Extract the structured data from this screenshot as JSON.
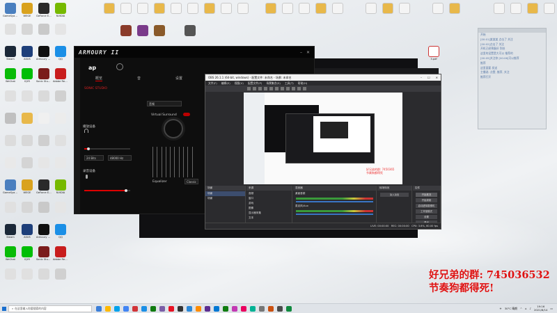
{
  "desktop": {
    "icons": [
      {
        "label": "GameSyaplay",
        "color": "#4a7fbf"
      },
      {
        "label": "WEGE",
        "color": "#d9a21e"
      },
      {
        "label": "GeForce Experience",
        "color": "#2a2a2a"
      },
      {
        "label": "NVIDIA",
        "color": "#76b900"
      },
      {
        "label": "",
        "color": "#e0e0e0"
      },
      {
        "label": "",
        "color": "#d6d6d6"
      },
      {
        "label": "",
        "color": "#c9c9c9"
      },
      {
        "label": "",
        "color": "#e5e5e5"
      },
      {
        "label": "Steam",
        "color": "#1b2838"
      },
      {
        "label": "ASUS",
        "color": "#1e3f7a"
      },
      {
        "label": "Armoury Crate",
        "color": "#101010"
      },
      {
        "label": "QQ",
        "color": "#1b8fe6"
      },
      {
        "label": "WeChat",
        "color": "#09bb07"
      },
      {
        "label": "IQIYI",
        "color": "#00be06"
      },
      {
        "label": "Sonic Studio",
        "color": "#7a1b1b"
      },
      {
        "label": "Adobe Reader",
        "color": "#c81d1d"
      },
      {
        "label": "",
        "color": "#e0e0e0"
      },
      {
        "label": "",
        "color": "#e0e0e0"
      },
      {
        "label": "",
        "color": "#dadada"
      },
      {
        "label": "",
        "color": "#d0d0d0"
      },
      {
        "label": "",
        "color": "#c0c0c0"
      },
      {
        "label": "",
        "color": "#e8b84a"
      },
      {
        "label": "",
        "color": "#f0f0f0"
      },
      {
        "label": "",
        "color": "#ececec"
      },
      {
        "label": "",
        "color": "#dcdcdc"
      },
      {
        "label": "",
        "color": "#d8d8d8"
      },
      {
        "label": "",
        "color": "#cfcfcf"
      },
      {
        "label": "",
        "color": "#e0e0e0"
      },
      {
        "label": "",
        "color": "#e9e9e9"
      },
      {
        "label": "",
        "color": "#d4d4d4"
      },
      {
        "label": "",
        "color": "#e6e6e6"
      },
      {
        "label": "",
        "color": "#e8e8e8"
      }
    ],
    "pdf_label": "3.pdf"
  },
  "armoury": {
    "logo": "ARMOURY II",
    "tabs": [
      "概览",
      "音",
      "设置"
    ],
    "sonic_studio": "SONIC STUDIO",
    "playback_device": "播放设备",
    "recording_device": "录音设备",
    "selected_app": "音频",
    "virtual_surround": "Virtual Surround",
    "equalizer": "Equalizer",
    "preset": "Classic",
    "sample_rate": "24 Bits",
    "freq": "48000 Hz"
  },
  "obs": {
    "title": "OBS 26.1.1 (64-bit, windows) - 配置文件: 未命名 - 场景: 未命名",
    "menu": [
      "文件(F)",
      "编辑(E)",
      "视图(V)",
      "配置文件(P)",
      "场景集合(S)",
      "工具(T)",
      "帮助(H)"
    ],
    "docks": {
      "scenes": "场景",
      "sources": "来源",
      "mixer": "混音器",
      "transitions": "转场特效",
      "controls": "控件"
    },
    "scene_rows": [
      "场景",
      "场景"
    ],
    "source_rows": [
      "音频",
      "窗口",
      "游戏",
      "图像",
      "显示器采集",
      "文本"
    ],
    "mixer_tracks": [
      "桌面音频",
      "麦克风/Aux"
    ],
    "transition_value": "淡入淡出",
    "controls": [
      "开始推流",
      "开始录制",
      "启动虚拟摄像机",
      "工作室模式",
      "设置",
      "退出"
    ],
    "status": "LIVE: 00:00:00   REC: 00:00:00   CPU: 3.6%, 60.00 fps",
    "inner_text": [
      "好兄弟的群: 7450365",
      "节奏狗都得死"
    ]
  },
  "notepad": {
    "lines": [
      "开始",
      "[00:01]某某某 点击了 关注",
      "[00:02]点击了 关注",
      "开机已经预备好 到处",
      "这里的设置是大可以 推荐的",
      "[00:05]关注你 [00:06]可以推荐",
      "推荐",
      "这里面要 发送",
      "主播说: 点赞, 推荐, 关注",
      "推荐打开"
    ]
  },
  "overlay": {
    "line1": "好兄弟的群: 745036532",
    "line2": "节奏狗都得死!"
  },
  "taskbar": {
    "search_placeholder": "在这里输入你要搜索的内容",
    "weather": "30°C 晴朗",
    "time": "19:16",
    "date": "2021/8/14",
    "pins": [
      "#3b7fd9",
      "#ffb900",
      "#00a2ed",
      "#4285f4",
      "#d13438",
      "#1b8fe6",
      "#0f7b0f",
      "#7b5ea7",
      "#e81123",
      "#333333",
      "#2b88d8",
      "#ff8c00",
      "#5c2d91",
      "#0078d4",
      "#107c10",
      "#c239b3",
      "#ea005e",
      "#00b294",
      "#767676",
      "#ca5010",
      "#4a4a4a",
      "#10893e"
    ]
  }
}
